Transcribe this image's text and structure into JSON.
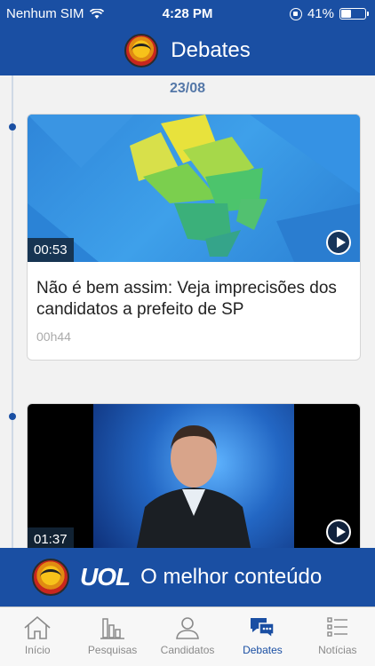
{
  "status": {
    "carrier": "Nenhum SIM",
    "time": "4:28 PM",
    "battery_text": "41%",
    "battery_level": 0.41
  },
  "header": {
    "title": "Debates"
  },
  "timeline": {
    "date": "23/08",
    "cards": [
      {
        "duration": "00:53",
        "headline": "Não é bem assim: Veja imprecisões dos candidatos a prefeito de SP",
        "ago": "00h44"
      },
      {
        "duration": "01:37"
      }
    ]
  },
  "banner": {
    "brand": "UOL",
    "slogan": "O melhor conteúdo"
  },
  "tabs": [
    {
      "label": "Início",
      "icon": "home-icon"
    },
    {
      "label": "Pesquisas",
      "icon": "bar-chart-icon"
    },
    {
      "label": "Candidatos",
      "icon": "person-icon"
    },
    {
      "label": "Debates",
      "icon": "chat-bubbles-icon",
      "active": true
    },
    {
      "label": "Notícias",
      "icon": "list-icon"
    }
  ],
  "colors": {
    "brand": "#1a4fa3",
    "tab_inactive": "#8a8a8a",
    "date_text": "#5578a8"
  }
}
